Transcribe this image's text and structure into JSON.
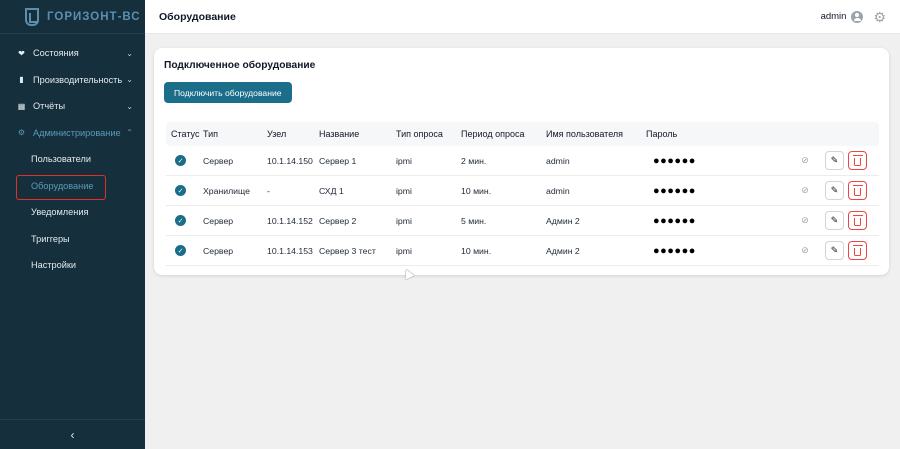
{
  "app": {
    "logo_text": "ГОРИЗОНТ-ВС"
  },
  "sidebar": {
    "items": [
      {
        "label": "Состояния",
        "icon": "heart-icon",
        "glyph": "❤",
        "chevron": "⌄"
      },
      {
        "label": "Производительность",
        "icon": "bar-chart-icon",
        "glyph": "▮",
        "chevron": "⌄"
      },
      {
        "label": "Отчёты",
        "icon": "calendar-icon",
        "glyph": "▦",
        "chevron": "⌄"
      },
      {
        "label": "Администрирование",
        "icon": "gear-icon",
        "glyph": "⚙",
        "chevron": "⌃"
      }
    ],
    "subitems": [
      "Пользователи",
      "Оборудование",
      "Уведомления",
      "Триггеры",
      "Настройки"
    ],
    "active_subitem": "Оборудование",
    "collapse_glyph": "‹"
  },
  "header": {
    "title": "Оборудование",
    "user": "admin",
    "gear_glyph": "⚙"
  },
  "card": {
    "title": "Подключенное оборудование",
    "connect_button": "Подключить оборудование"
  },
  "table": {
    "columns": [
      "Статус",
      "Тип",
      "Узел",
      "Название",
      "Тип опроса",
      "Период опроса",
      "Имя пользователя",
      "Пароль"
    ],
    "rows": [
      {
        "status": "✓",
        "type": "Сервер",
        "host": "10.1.14.150",
        "name": "Сервер 1",
        "poll_type": "ipmi",
        "period": "2 мин.",
        "user": "admin",
        "password": "●●●●●●"
      },
      {
        "status": "✓",
        "type": "Хранилище",
        "host": "-",
        "name": "СХД 1",
        "poll_type": "ipmi",
        "period": "10 мин.",
        "user": "admin",
        "password": "●●●●●●"
      },
      {
        "status": "✓",
        "type": "Сервер",
        "host": "10.1.14.152",
        "name": "Сервер 2",
        "poll_type": "ipmi",
        "period": "5 мин.",
        "user": "Админ 2",
        "password": "●●●●●●"
      },
      {
        "status": "✓",
        "type": "Сервер",
        "host": "10.1.14.153",
        "name": "Сервер 3 тест",
        "poll_type": "ipmi",
        "period": "10 мин.",
        "user": "Админ 2",
        "password": "●●●●●●"
      }
    ],
    "eye_glyph": "⊘",
    "edit_glyph": "✎"
  },
  "colors": {
    "sidebar_bg": "#15303c",
    "accent": "#1b6e8a",
    "active_text": "#5b9ab6",
    "danger": "#ef4444",
    "highlight": "#e0302a"
  }
}
